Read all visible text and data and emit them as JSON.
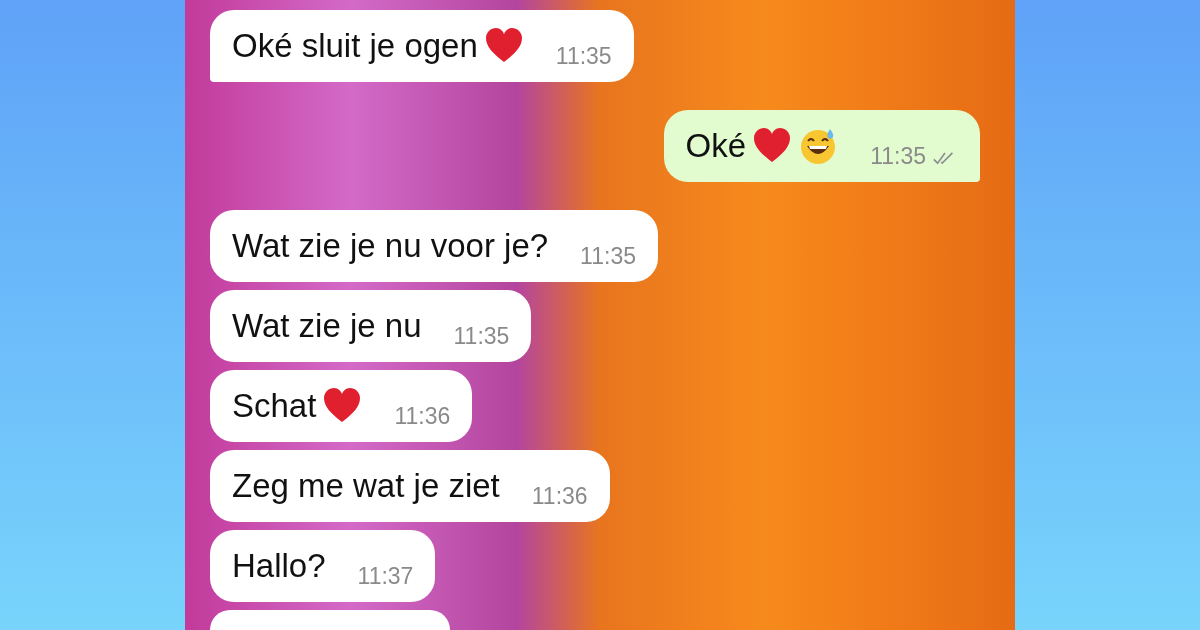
{
  "messages": [
    {
      "kind": "incoming",
      "text": "Oké sluit je ogen",
      "emoji": [
        {
          "kind": "heart"
        }
      ],
      "time": "11:35",
      "tail": true
    },
    {
      "kind": "outgoing",
      "text": "Oké",
      "emoji": [
        {
          "kind": "heart"
        },
        {
          "kind": "sweat-smile"
        }
      ],
      "time": "11:35",
      "tail": true,
      "read": false
    },
    {
      "kind": "incoming",
      "text": "Wat zie je nu voor je?",
      "time": "11:35",
      "tail": false
    },
    {
      "kind": "incoming",
      "text": "Wat zie je nu",
      "time": "11:35",
      "tail": false
    },
    {
      "kind": "incoming",
      "text": "Schat",
      "emoji": [
        {
          "kind": "heart"
        }
      ],
      "time": "11:36",
      "tail": false
    },
    {
      "kind": "incoming",
      "text": "Zeg me wat je ziet",
      "time": "11:36",
      "tail": false
    },
    {
      "kind": "incoming",
      "text": "Hallo?",
      "time": "11:37",
      "tail": false
    },
    {
      "kind": "cut"
    }
  ]
}
